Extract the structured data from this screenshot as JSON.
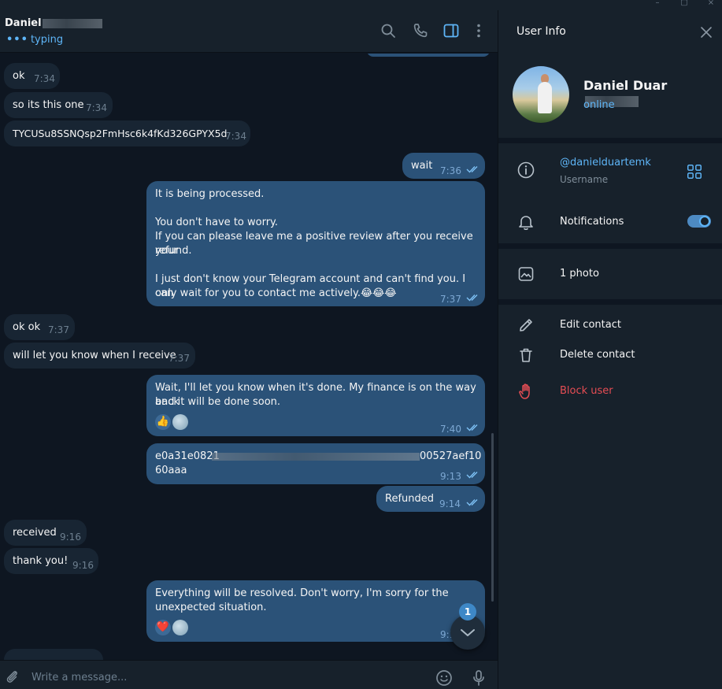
{
  "window": {
    "controls": [
      "–",
      "▢",
      "×"
    ]
  },
  "chat": {
    "peer_name": "Daniel",
    "status": "typing",
    "composer_placeholder": "Write a message...",
    "unread_count": "1",
    "messages": [
      {
        "dir": "in",
        "text": "ok",
        "time": "7:34"
      },
      {
        "dir": "in",
        "text": "so its this one",
        "time": "7:34"
      },
      {
        "dir": "in",
        "text": "TYCUSu8SSNQsp2FmHsc6k4fKd326GPYX5d",
        "time": "7:34"
      },
      {
        "dir": "out",
        "text": "wait",
        "time": "7:36"
      },
      {
        "dir": "out",
        "lines": [
          "It is being processed.",
          "",
          "You don't have to worry.",
          "If you can please leave me a positive review after you receive your",
          "refund.",
          "",
          "I just don't know your Telegram account and can't find you. I can",
          "only wait for you to contact me actively.😂😂😂"
        ],
        "time": "7:37"
      },
      {
        "dir": "in",
        "text": "ok ok",
        "time": "7:37"
      },
      {
        "dir": "in",
        "text": "will let you know when I receive",
        "time": "7:37"
      },
      {
        "dir": "out",
        "lines": [
          "Wait, I'll let you know when it's done. My finance is on the way back",
          "and it will be done soon."
        ],
        "reactions": [
          "👍"
        ],
        "time": "7:40"
      },
      {
        "dir": "out",
        "lines": [
          "e0a31e0821",
          "60aaa"
        ],
        "tail_visible": "00527aef10",
        "time": "9:13"
      },
      {
        "dir": "out",
        "text": "Refunded",
        "time": "9:14"
      },
      {
        "dir": "in",
        "text": "received",
        "time": "9:16"
      },
      {
        "dir": "in",
        "text": "thank you!",
        "time": "9:16"
      },
      {
        "dir": "out",
        "lines": [
          "Everything will be resolved. Don't worry, I'm sorry for the",
          "unexpected situation."
        ],
        "reactions": [
          "❤️"
        ],
        "time": "9:1"
      }
    ]
  },
  "info": {
    "title": "User Info",
    "name": "Daniel Duar",
    "status": "online",
    "username": "@danielduartemk",
    "username_label": "Username",
    "notifications_label": "Notifications",
    "notifications_on": true,
    "media_label": "1 photo",
    "actions": {
      "edit": "Edit contact",
      "delete": "Delete contact",
      "block": "Block user"
    }
  },
  "colors": {
    "background": "#0e1621",
    "panel": "#17212b",
    "incoming_bubble": "#182533",
    "outgoing_bubble": "#2b5278",
    "accent": "#5eb5f7",
    "danger": "#e64d54"
  }
}
